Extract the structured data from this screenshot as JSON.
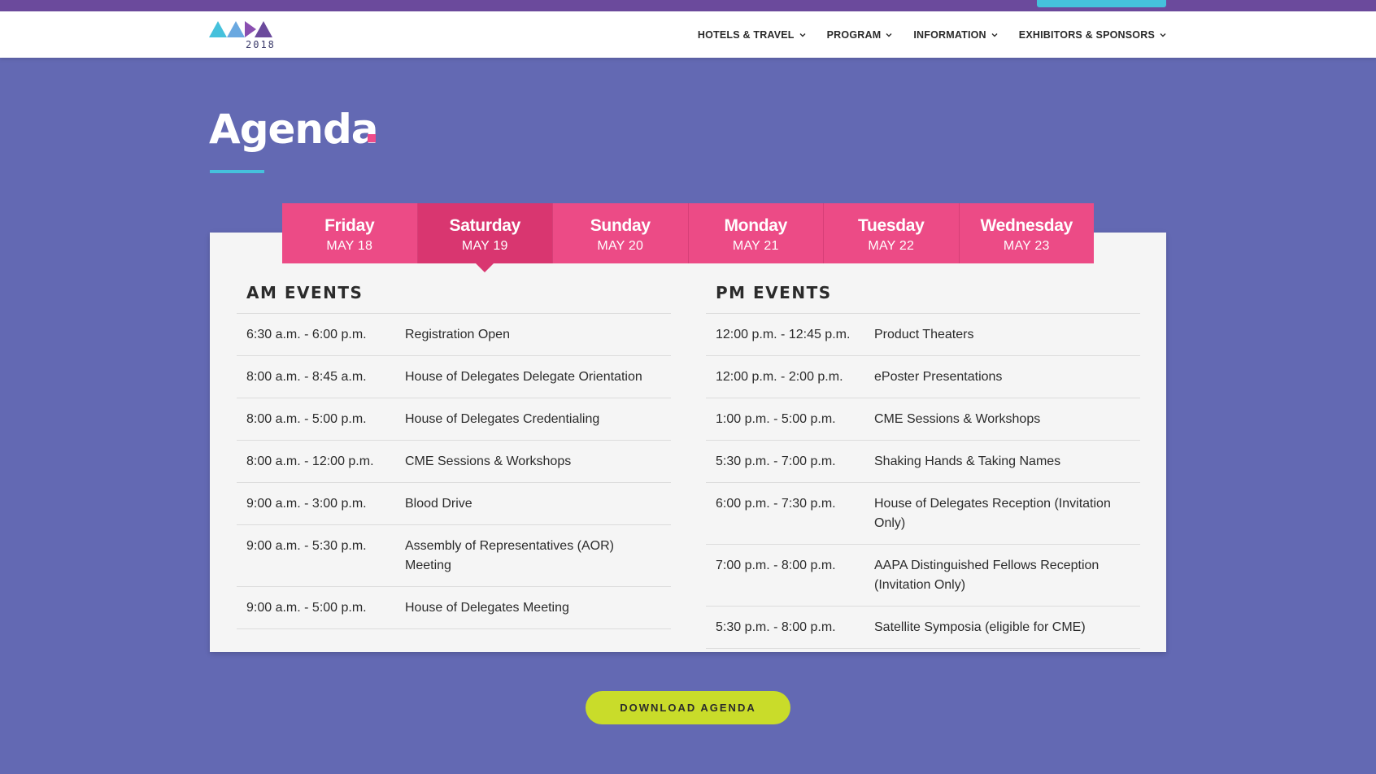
{
  "header": {
    "logo_text": "AAPA",
    "logo_year": "2018",
    "nav": [
      {
        "label": "HOTELS & TRAVEL",
        "icon": "chevron-down-icon"
      },
      {
        "label": "PROGRAM",
        "icon": "chevron-down-icon"
      },
      {
        "label": "INFORMATION",
        "icon": "chevron-down-icon"
      },
      {
        "label": "EXHIBITORS & SPONSORS",
        "icon": "chevron-down-icon"
      }
    ]
  },
  "page": {
    "title": "Agenda"
  },
  "tabs": [
    {
      "day": "Friday",
      "date": "MAY 18",
      "active": false
    },
    {
      "day": "Saturday",
      "date": "MAY 19",
      "active": true
    },
    {
      "day": "Sunday",
      "date": "MAY 20",
      "active": false
    },
    {
      "day": "Monday",
      "date": "MAY 21",
      "active": false
    },
    {
      "day": "Tuesday",
      "date": "MAY 22",
      "active": false
    },
    {
      "day": "Wednesday",
      "date": "MAY 23",
      "active": false
    }
  ],
  "am": {
    "heading": "AM EVENTS",
    "events": [
      {
        "time": "6:30 a.m. - 6:00 p.m.",
        "name": "Registration Open"
      },
      {
        "time": "8:00 a.m. - 8:45 a.m.",
        "name": "House of Delegates Delegate Orientation"
      },
      {
        "time": "8:00 a.m. - 5:00 p.m.",
        "name": "House of Delegates Credentialing"
      },
      {
        "time": "8:00 a.m. - 12:00 p.m.",
        "name": "CME Sessions & Workshops"
      },
      {
        "time": "9:00 a.m. - 3:00 p.m.",
        "name": "Blood Drive"
      },
      {
        "time": "9:00 a.m. - 5:30 p.m.",
        "name": "Assembly of Representatives (AOR) Meeting"
      },
      {
        "time": "9:00 a.m. - 5:00 p.m.",
        "name": "House of Delegates Meeting"
      }
    ]
  },
  "pm": {
    "heading": "PM EVENTS",
    "events": [
      {
        "time": "12:00 p.m. - 12:45 p.m.",
        "name": "Product Theaters"
      },
      {
        "time": "12:00 p.m. - 2:00 p.m.",
        "name": "ePoster Presentations"
      },
      {
        "time": "1:00 p.m. - 5:00 p.m.",
        "name": "CME Sessions & Workshops"
      },
      {
        "time": "5:30 p.m. - 7:00 p.m.",
        "name": "Shaking Hands & Taking Names"
      },
      {
        "time": "6:00 p.m. - 7:30 p.m.",
        "name": "House of Delegates Reception (Invitation Only)"
      },
      {
        "time": "7:00 p.m. - 8:00 p.m.",
        "name": "AAPA Distinguished Fellows Reception (Invitation Only)"
      },
      {
        "time": "5:30 p.m. - 8:00 p.m.",
        "name": "Satellite Symposia (eligible for CME)"
      }
    ]
  },
  "actions": {
    "download_label": "DOWNLOAD AGENDA"
  },
  "colors": {
    "background": "#6369b3",
    "tab": "#ec4b86",
    "tab_active": "#d93670",
    "accent_cyan": "#45c1dc",
    "accent_pink": "#ee4c8a",
    "button": "#c9dc2a",
    "top_strip": "#6b4a9c"
  }
}
